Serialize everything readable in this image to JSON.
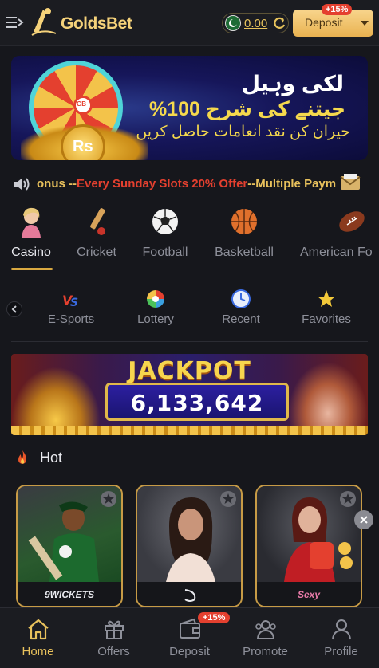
{
  "header": {
    "logo_text": "GoldsBet",
    "balance": "0.00",
    "deposit_label": "Deposit",
    "deposit_badge": "+15%"
  },
  "banner": {
    "line1": "لکی وہیل",
    "line2": "جیتنے کی شرح 100%",
    "line3": "حیران کن نقد انعامات حاصل کریں",
    "coin_label": "Rs",
    "wheel_label": "GB",
    "dot_count": 8,
    "active_dot": 3
  },
  "marquee": {
    "part1": "onus --",
    "part2": "Every Sunday Slots 20% Offer",
    "part3": "--Multiple Paym"
  },
  "categories": [
    {
      "label": "Casino",
      "icon": "casino-icon",
      "active": true
    },
    {
      "label": "Cricket",
      "icon": "cricket-icon",
      "active": false
    },
    {
      "label": "Football",
      "icon": "football-icon",
      "active": false
    },
    {
      "label": "Basketball",
      "icon": "basketball-icon",
      "active": false
    },
    {
      "label": "American Fo",
      "icon": "american-football-icon",
      "active": false
    }
  ],
  "subtabs": [
    {
      "label": "E-Sports",
      "icon": "esports-icon"
    },
    {
      "label": "Lottery",
      "icon": "lottery-icon"
    },
    {
      "label": "Recent",
      "icon": "clock-icon"
    },
    {
      "label": "Favorites",
      "icon": "star-icon"
    }
  ],
  "jackpot": {
    "title": "JACKPOT",
    "amount": "6,133,642"
  },
  "hot": {
    "title": "Hot",
    "games": [
      {
        "brand": "9WICKETS",
        "name": "cricket-game"
      },
      {
        "brand": "",
        "name": "portrait-game"
      },
      {
        "brand": "Sexy",
        "name": "baccarat-game"
      }
    ]
  },
  "bottom_nav": {
    "items": [
      {
        "label": "Home",
        "icon": "home-icon",
        "active": true
      },
      {
        "label": "Offers",
        "icon": "gift-icon",
        "active": false
      },
      {
        "label": "Deposit",
        "icon": "wallet-icon",
        "active": false
      },
      {
        "label": "Promote",
        "icon": "people-icon",
        "active": false
      },
      {
        "label": "Profile",
        "icon": "profile-icon",
        "active": false
      }
    ],
    "deposit_badge": "+15%"
  },
  "colors": {
    "accent_gold": "#e8c15c",
    "background": "#16171c",
    "badge_red": "#e4402f"
  }
}
